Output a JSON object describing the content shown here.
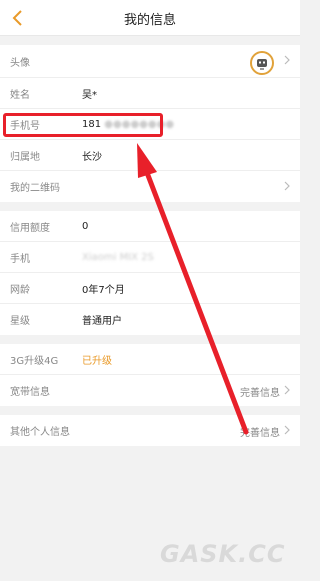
{
  "header": {
    "title": "我的信息"
  },
  "group1": {
    "avatar_label": "头像",
    "name_label": "姓名",
    "name_value": "吴*",
    "phone_label": "手机号",
    "phone_value": "181",
    "region_label": "归属地",
    "region_value": "长沙",
    "qr_label": "我的二维码"
  },
  "group2": {
    "credit_label": "信用额度",
    "credit_value": "0",
    "device_label": "手机",
    "device_value": "Xiaomi MIX 2S",
    "age_label": "网龄",
    "age_value": "0年7个月",
    "star_label": "星级",
    "star_value": "普通用户"
  },
  "group3": {
    "upgrade_label": "3G升级4G",
    "upgrade_value": "已升级",
    "broadband_label": "宽带信息",
    "broadband_action": "完善信息"
  },
  "group4": {
    "other_label": "其他个人信息",
    "other_action": "完善信息"
  },
  "watermark": "GASK.CC",
  "colors": {
    "accent": "#e99a29",
    "annotation": "#e8202a"
  }
}
